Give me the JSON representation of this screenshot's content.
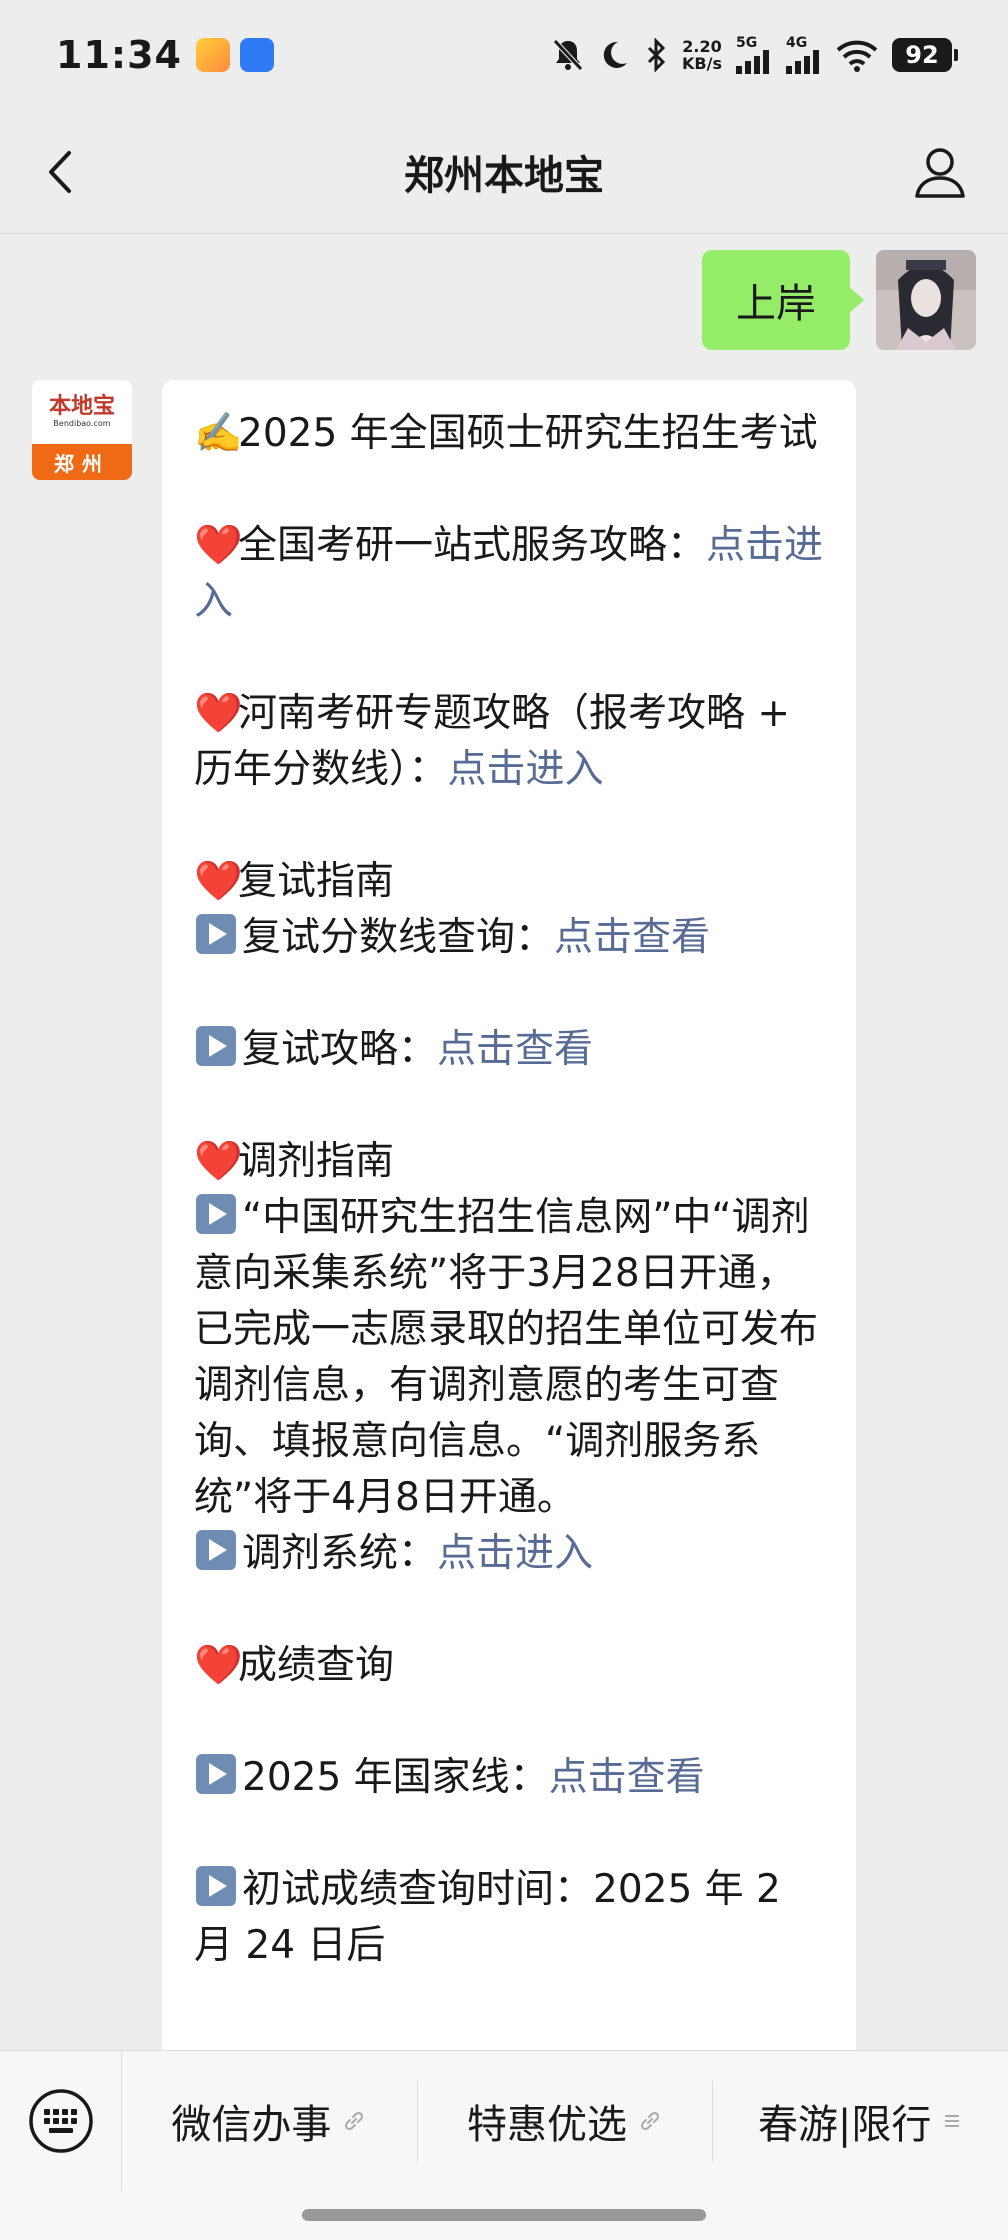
{
  "status_bar": {
    "time": "11:34",
    "net_speed_value": "2.20",
    "net_speed_unit": "KB/s",
    "sig1_label": "5G",
    "sig2_label": "4G",
    "battery": "92"
  },
  "nav": {
    "title": "郑州本地宝"
  },
  "outgoing": {
    "text": "上岸"
  },
  "bot_avatar": {
    "logo": "本地宝",
    "sub": "Bendibao.com",
    "city": "郑州"
  },
  "message": {
    "p1_emoji": "✍️",
    "p1_text": "2025 年全国硕士研究生招生考试",
    "p2_text": "全国考研一站式服务攻略：",
    "p2_link": "点击进入",
    "p3_text": "河南考研专题攻略（报考攻略 + 历年分数线）：",
    "p3_link": "点击进入",
    "p4_heading": "复试指南",
    "p4_item_text": "复试分数线查询：",
    "p4_item_link": "点击查看",
    "p5_text": "复试攻略：",
    "p5_link": "点击查看",
    "p6_heading": "调剂指南",
    "p6_body": "“中国研究生招生信息网”中“调剂意向采集系统”将于3月28日开通，已完成一志愿录取的招生单位可发布调剂信息，有调剂意愿的考生可查询、填报意向信息。“调剂服务系统”将于4月8日开通。",
    "p6_item_text": "调剂系统：",
    "p6_item_link": "点击进入",
    "p7_heading": "成绩查询",
    "p8_text": "2025 年国家线：",
    "p8_link": "点击查看",
    "p9_text": "初试成绩查询时间：2025 年 2 月 24 日后",
    "heart": "❤️"
  },
  "menu": {
    "item1": "微信办事",
    "item2": "特惠优选",
    "item3": "春游|限行"
  },
  "icons": {
    "back": "chevron-left-icon",
    "profile": "person-icon",
    "keyboard": "keyboard-icon",
    "link_suffix": "link-icon",
    "list_suffix": "list-icon"
  },
  "colors": {
    "outgoing_bubble": "#95ec69",
    "link": "#576b95",
    "background": "#ededed",
    "heart": "#e01b1b"
  }
}
